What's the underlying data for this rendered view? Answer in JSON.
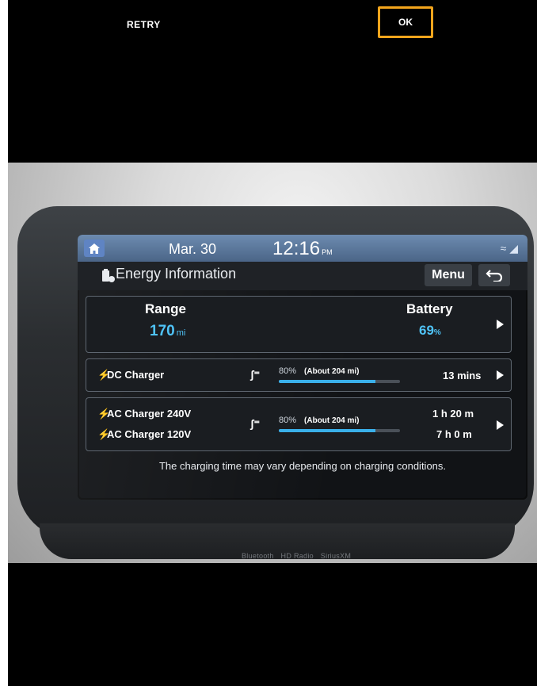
{
  "camera_controls": {
    "retry_label": "RETRY",
    "ok_label": "OK",
    "accent_color": "#f4a51c"
  },
  "screen": {
    "status_bar": {
      "date": "Mar. 30",
      "time": "12:16",
      "ampm": "PM",
      "home_icon": "home-icon",
      "status_icons": "≈ ◢"
    },
    "header": {
      "title": "Energy Information",
      "menu_label": "Menu",
      "back_icon": "back-arrow-icon"
    },
    "summary": {
      "range_label": "Range",
      "range_value": "170",
      "range_unit": "mi",
      "battery_label": "Battery",
      "battery_value": "69",
      "battery_unit": "%"
    },
    "dc_charger": {
      "name": "DC Charger",
      "target_pct": "80%",
      "target_range": "(About 204 mi)",
      "progress": 0.8,
      "time": "13 mins"
    },
    "ac_charger": {
      "name_240": "AC Charger 240V",
      "name_120": "AC Charger 120V",
      "target_pct": "80%",
      "target_range": "(About 204 mi)",
      "progress": 0.8,
      "time_240": "1 h 20 m",
      "time_120": "7 h 0 m"
    },
    "notice": "The charging time may vary depending on charging conditions."
  },
  "bezel": {
    "bluetooth": "Bluetooth",
    "hd_radio": "HD Radio",
    "siriusxm": "SiriusXM"
  },
  "colors": {
    "highlight_blue": "#4fc3f7",
    "status_bar": "#5a7aa0"
  }
}
